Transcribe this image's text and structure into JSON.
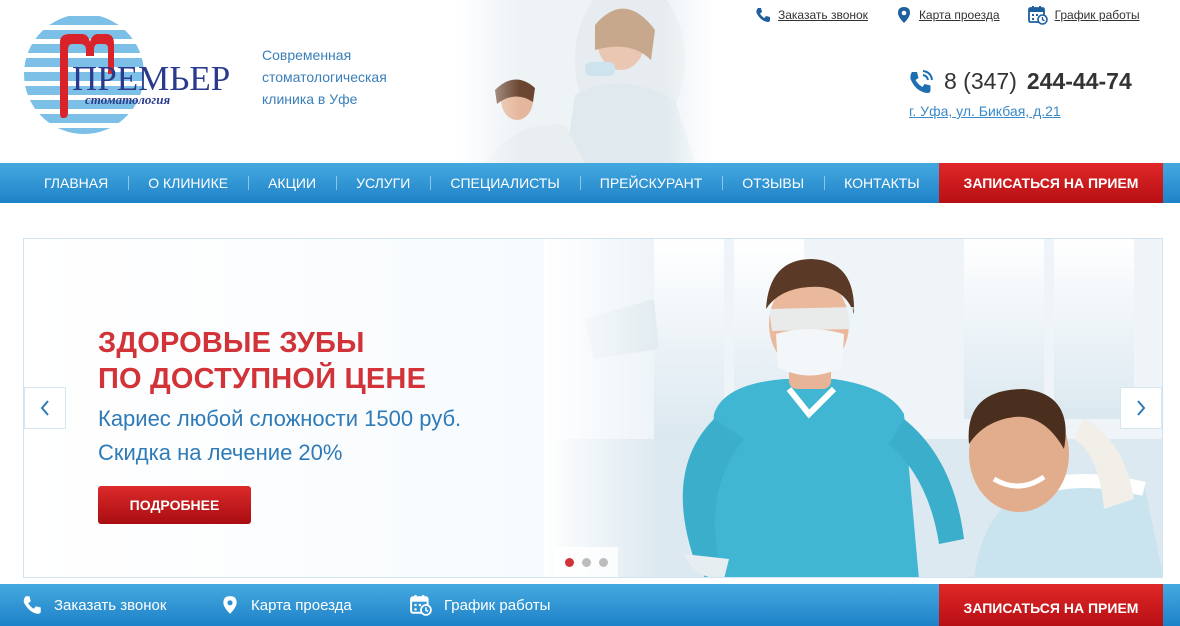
{
  "brand": {
    "logo_main": "ПРЕМЬЕР",
    "logo_sub": "стоматология",
    "tagline": [
      "Современная",
      "стоматологическая",
      "клиника в Уфе"
    ]
  },
  "top_links": [
    {
      "label": "Заказать звонок",
      "icon": "phone-icon"
    },
    {
      "label": "Карта проезда",
      "icon": "map-pin-icon"
    },
    {
      "label": "График работы",
      "icon": "calendar-icon"
    }
  ],
  "contact": {
    "phone_prefix": "8 (347)",
    "phone_number": "244-44-74",
    "address": "г. Уфа, ул. Бикбая, д.21"
  },
  "nav": {
    "items": [
      "ГЛАВНАЯ",
      "О КЛИНИКЕ",
      "АКЦИИ",
      "УСЛУГИ",
      "СПЕЦИАЛИСТЫ",
      "ПРЕЙСКУРАНТ",
      "ОТЗЫВЫ",
      "КОНТАКТЫ"
    ],
    "cta": "ЗАПИСАТЬСЯ НА ПРИЕМ"
  },
  "slider": {
    "headline": [
      "ЗДОРОВЫЕ ЗУБЫ",
      "ПО ДОСТУПНОЙ ЦЕНЕ"
    ],
    "subline": [
      "Кариес любой сложности 1500 руб.",
      "Скидка на лечение 20%"
    ],
    "button": "ПОДРОБНЕЕ",
    "slides_total": 3,
    "active_slide": 1
  },
  "bottom_bar": {
    "links": [
      {
        "label": "Заказать звонок",
        "icon": "phone-icon"
      },
      {
        "label": "Карта проезда",
        "icon": "map-pin-icon"
      },
      {
        "label": "График работы",
        "icon": "calendar-icon"
      }
    ],
    "cta": "ЗАПИСАТЬСЯ НА ПРИЕМ"
  },
  "colors": {
    "accent_blue": "#2d8fd4",
    "accent_red": "#d13338",
    "text_blue": "#2f7bb8"
  }
}
